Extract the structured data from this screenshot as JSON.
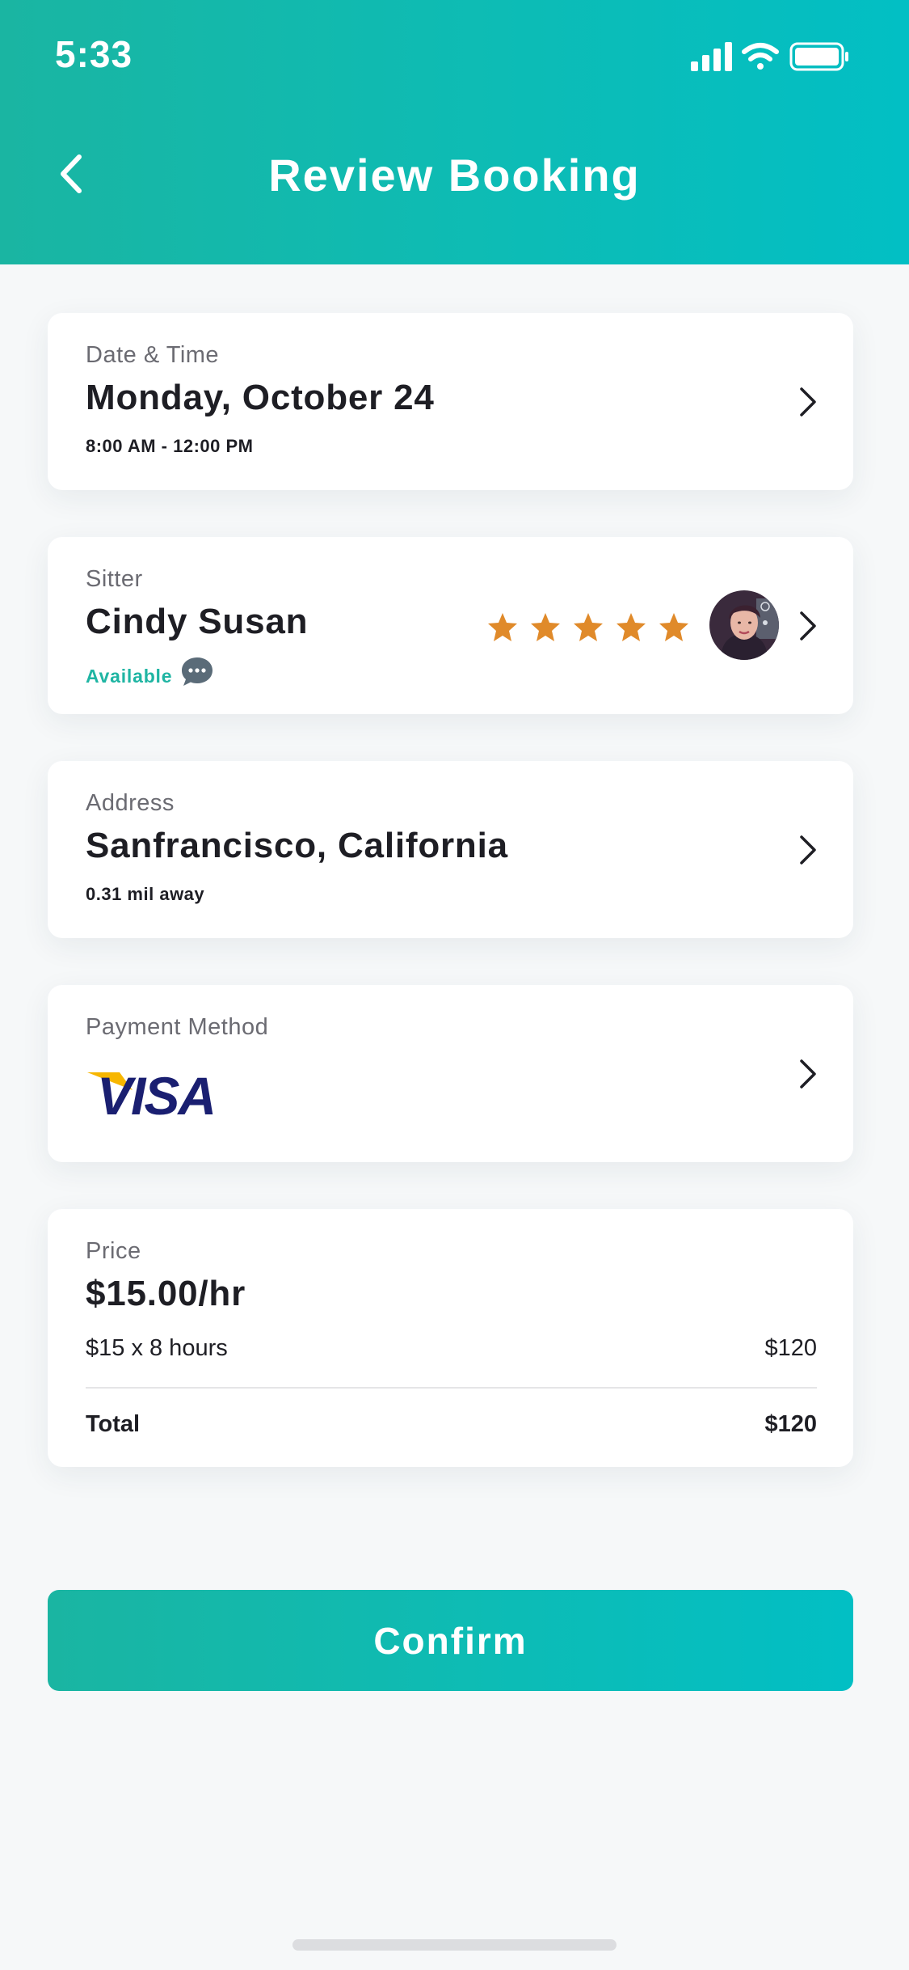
{
  "status_bar": {
    "time": "5:33",
    "icons": [
      "signal-icon",
      "wifi-icon",
      "battery-icon"
    ]
  },
  "header": {
    "title": "Review Booking",
    "back_icon": "chevron-left-icon"
  },
  "cards": {
    "date_time": {
      "label": "Date & Time",
      "value": "Monday, October 24",
      "sub": "8:00 AM - 12:00 PM"
    },
    "sitter": {
      "label": "Sitter",
      "name": "Cindy Susan",
      "status": "Available",
      "rating": 5,
      "rating_max": 5
    },
    "address": {
      "label": "Address",
      "value": "Sanfrancisco, California",
      "sub": "0.31 mil away"
    },
    "payment": {
      "label": "Payment Method",
      "logo_text": "VISA"
    },
    "price": {
      "label": "Price",
      "rate": "$15.00/hr",
      "calc_label": "$15 x 8 hours",
      "calc_amount": "$120",
      "total_label": "Total",
      "total_amount": "$120"
    }
  },
  "confirm_button": "Confirm",
  "colors": {
    "accent": "#0dbcb5",
    "available": "#1fb5a3",
    "star": "#e08a2a",
    "visa_blue": "#1a1f71",
    "visa_gold": "#f7b600"
  }
}
